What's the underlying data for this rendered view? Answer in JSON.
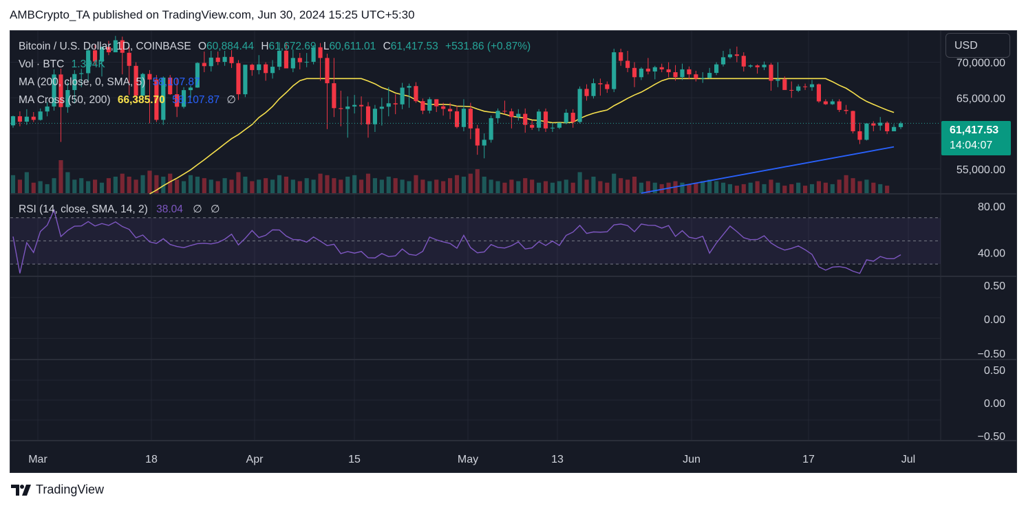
{
  "header": {
    "published_line": "AMBCrypto_TA published on TradingView.com, Jun 30, 2024 15:25 UTC+5:30"
  },
  "legend": {
    "symbol": "Bitcoin / U.S. Dollar, 1D, COINBASE",
    "open_label": "O",
    "open": "60,884.44",
    "high_label": "H",
    "high": "61,672.69",
    "low_label": "L",
    "low": "60,611.01",
    "close_label": "C",
    "close": "61,417.53",
    "change": "+531.86 (+0.87%)",
    "vol_label": "Vol · BTC",
    "vol_value": "1.394K",
    "ma_label": "MA (200, close, 0, SMA, 5)",
    "ma_value": "58,107.87",
    "macross_label": "MA Cross (50, 200)",
    "macross_fast": "66,385.70",
    "macross_slow": "58,107.87",
    "macross_extra": "∅"
  },
  "rsi_legend": {
    "label": "RSI (14, close, SMA, 14, 2)",
    "value": "38.04",
    "extra1": "∅",
    "extra2": "∅"
  },
  "currency_button": "USD",
  "price_badge": {
    "price": "61,417.53",
    "countdown": "14:04:07"
  },
  "footer": {
    "brand": "TradingView"
  },
  "colors": {
    "up": "#26a69a",
    "down": "#f23645",
    "ma200": "#2962ff",
    "ma50": "#f7e14d",
    "rsi": "#7e57c2",
    "bg": "#161a25",
    "grid": "#232733",
    "text": "#d1d4dc"
  },
  "chart_data": {
    "type": "candlestick",
    "x_ticks": [
      "Mar",
      "18",
      "Apr",
      "15",
      "May",
      "13",
      "Jun",
      "17",
      "Jul"
    ],
    "price_axis_ticks": [
      "70,000.00",
      "65,000.00",
      "55,000.00"
    ],
    "rsi_axis_ticks": [
      "80.00",
      "40.00"
    ],
    "empty_pane_1_ticks": [
      "0.50",
      "0.00",
      "−0.50"
    ],
    "empty_pane_2_ticks": [
      "0.50",
      "0.00",
      "−0.50"
    ],
    "ylim_price": [
      51600,
      74400
    ],
    "ylim_rsi": [
      20,
      90
    ],
    "last_price": 61417.53,
    "candles": [
      [
        61132,
        62500,
        60800,
        62410
      ],
      [
        62410,
        63100,
        61000,
        61650
      ],
      [
        61650,
        63400,
        61200,
        62350
      ],
      [
        62350,
        63000,
        61600,
        61900
      ],
      [
        61900,
        63500,
        61800,
        63080
      ],
      [
        63080,
        64400,
        62400,
        63780
      ],
      [
        63780,
        69000,
        63200,
        68280
      ],
      [
        68280,
        69100,
        58800,
        63700
      ],
      [
        63700,
        67200,
        62900,
        66090
      ],
      [
        66090,
        68900,
        64200,
        68340
      ],
      [
        68340,
        69050,
        66500,
        68460
      ],
      [
        68460,
        72000,
        67400,
        71670
      ],
      [
        71670,
        72500,
        69600,
        70100
      ],
      [
        70100,
        72200,
        68000,
        72150
      ],
      [
        72150,
        73000,
        71000,
        71400
      ],
      [
        71400,
        73700,
        72000,
        73090
      ],
      [
        73090,
        73600,
        68300,
        71330
      ],
      [
        71330,
        72400,
        65400,
        69490
      ],
      [
        69490,
        70000,
        64500,
        65320
      ],
      [
        65320,
        68500,
        64800,
        68350
      ],
      [
        68350,
        68900,
        61400,
        67570
      ],
      [
        67570,
        68200,
        61600,
        61900
      ],
      [
        61900,
        68000,
        61200,
        67840
      ],
      [
        67840,
        68200,
        65400,
        65500
      ],
      [
        65500,
        67700,
        62300,
        63740
      ],
      [
        63740,
        66500,
        63500,
        66080
      ],
      [
        66080,
        66700,
        65000,
        66440
      ],
      [
        66440,
        70000,
        66400,
        69900
      ],
      [
        69900,
        71500,
        68600,
        69450
      ],
      [
        69450,
        71600,
        68700,
        70650
      ],
      [
        70650,
        71500,
        69600,
        70050
      ],
      [
        70050,
        71600,
        69500,
        70750
      ],
      [
        70750,
        71700,
        69200,
        69870
      ],
      [
        69870,
        70300,
        64700,
        65500
      ],
      [
        65500,
        69600,
        65100,
        69650
      ],
      [
        69650,
        69800,
        68100,
        68900
      ],
      [
        68900,
        71000,
        68300,
        69700
      ],
      [
        69700,
        70000,
        67400,
        68480
      ],
      [
        68480,
        70300,
        67700,
        69370
      ],
      [
        69370,
        72800,
        68900,
        71620
      ],
      [
        71620,
        72800,
        69600,
        69140
      ],
      [
        69140,
        71800,
        68600,
        70600
      ],
      [
        70600,
        71300,
        69000,
        70000
      ],
      [
        70000,
        71300,
        69300,
        70060
      ],
      [
        70060,
        72400,
        69700,
        72100
      ],
      [
        72100,
        72700,
        67400,
        70600
      ],
      [
        70600,
        71200,
        60600,
        67050
      ],
      [
        67050,
        70600,
        62300,
        63550
      ],
      [
        63550,
        66000,
        61000,
        63430
      ],
      [
        63430,
        65200,
        59400,
        63780
      ],
      [
        63780,
        65400,
        62800,
        64000
      ],
      [
        64000,
        65200,
        61200,
        63800
      ],
      [
        63800,
        64400,
        59400,
        61280
      ],
      [
        61280,
        64000,
        60200,
        63460
      ],
      [
        63460,
        65000,
        61100,
        63750
      ],
      [
        63750,
        66500,
        62400,
        64230
      ],
      [
        64230,
        65500,
        62700,
        64080
      ],
      [
        64080,
        67100,
        63400,
        66430
      ],
      [
        66430,
        67000,
        63600,
        66650
      ],
      [
        66650,
        67200,
        64300,
        64530
      ],
      [
        64530,
        64900,
        62700,
        63200
      ],
      [
        63200,
        65100,
        62800,
        64800
      ],
      [
        64800,
        64800,
        63000,
        63800
      ],
      [
        63800,
        64300,
        62500,
        63440
      ],
      [
        63440,
        64300,
        62000,
        63100
      ],
      [
        63100,
        63900,
        60700,
        60900
      ],
      [
        60900,
        64800,
        60300,
        63470
      ],
      [
        63470,
        64300,
        59200,
        60700
      ],
      [
        60700,
        61200,
        57000,
        58300
      ],
      [
        58300,
        60000,
        56500,
        59100
      ],
      [
        59100,
        62500,
        58700,
        62140
      ],
      [
        62140,
        63500,
        61400,
        63160
      ],
      [
        63160,
        64600,
        62700,
        63100
      ],
      [
        63100,
        63500,
        60700,
        62300
      ],
      [
        62300,
        63400,
        61800,
        62750
      ],
      [
        62750,
        63500,
        60100,
        61200
      ],
      [
        61200,
        61800,
        60500,
        60800
      ],
      [
        60800,
        63400,
        60300,
        63070
      ],
      [
        63070,
        63500,
        60200,
        60700
      ],
      [
        60700,
        61400,
        60200,
        60800
      ],
      [
        60800,
        61500,
        60600,
        61500
      ],
      [
        61500,
        63400,
        61300,
        62900
      ],
      [
        62900,
        63400,
        60800,
        61600
      ],
      [
        61600,
        66600,
        61400,
        66250
      ],
      [
        66250,
        66900,
        64600,
        65250
      ],
      [
        65250,
        67700,
        64900,
        67050
      ],
      [
        67050,
        67700,
        65300,
        66900
      ],
      [
        66900,
        67300,
        65700,
        66230
      ],
      [
        66230,
        71900,
        65800,
        71400
      ],
      [
        71400,
        71900,
        69500,
        70200
      ],
      [
        70200,
        71600,
        68600,
        69200
      ],
      [
        69200,
        70000,
        66500,
        67900
      ],
      [
        67900,
        69300,
        67500,
        69100
      ],
      [
        69100,
        70600,
        68300,
        68700
      ],
      [
        68700,
        69500,
        67600,
        69300
      ],
      [
        69300,
        69800,
        68600,
        69000
      ],
      [
        69000,
        70000,
        67900,
        68600
      ],
      [
        68600,
        69600,
        67400,
        67900
      ],
      [
        67900,
        69800,
        67500,
        69000
      ],
      [
        69000,
        69400,
        67600,
        68300
      ],
      [
        68300,
        68800,
        67300,
        67700
      ],
      [
        67700,
        68600,
        67100,
        67800
      ],
      [
        67800,
        69200,
        67700,
        68500
      ],
      [
        68500,
        70000,
        68200,
        69700
      ],
      [
        69700,
        71600,
        69400,
        70700
      ],
      [
        70700,
        71900,
        70500,
        71100
      ],
      [
        71100,
        72200,
        70000,
        70900
      ],
      [
        70900,
        71400,
        68700,
        69400
      ],
      [
        69400,
        69700,
        69200,
        69550
      ],
      [
        69550,
        69700,
        68400,
        69300
      ],
      [
        69300,
        70100,
        68900,
        69650
      ],
      [
        69650,
        69900,
        66000,
        67400
      ],
      [
        67400,
        70000,
        66500,
        67600
      ],
      [
        67600,
        68000,
        66300,
        66100
      ],
      [
        66100,
        67300,
        65000,
        66000
      ],
      [
        66000,
        66900,
        65800,
        66600
      ],
      [
        66600,
        67000,
        66100,
        66500
      ],
      [
        66500,
        67500,
        66000,
        66900
      ],
      [
        66900,
        67000,
        64300,
        64500
      ],
      [
        64500,
        64800,
        64000,
        64100
      ],
      [
        64100,
        64800,
        64000,
        64500
      ],
      [
        64500,
        64800,
        63000,
        63300
      ],
      [
        63300,
        64000,
        62700,
        63150
      ],
      [
        63150,
        63200,
        60000,
        60300
      ],
      [
        60300,
        61500,
        58500,
        59100
      ],
      [
        59100,
        61200,
        59000,
        61400
      ],
      [
        61400,
        61700,
        60300,
        61100
      ],
      [
        61100,
        62300,
        60400,
        61500
      ],
      [
        61500,
        61700,
        59900,
        60300
      ],
      [
        60300,
        61300,
        60300,
        60900
      ],
      [
        60884,
        61673,
        60611,
        61418
      ]
    ],
    "volume_approx_btc": [
      12,
      9,
      14,
      7,
      8,
      6,
      10,
      22,
      14,
      9,
      10,
      8,
      9,
      7,
      10,
      11,
      13,
      11,
      9,
      12,
      15,
      12,
      11,
      13,
      9,
      8,
      12,
      11,
      10,
      9,
      8,
      10,
      9,
      14,
      11,
      8,
      9,
      10,
      9,
      12,
      11,
      9,
      8,
      10,
      9,
      13,
      12,
      10,
      9,
      11,
      12,
      9,
      13,
      10,
      9,
      11,
      10,
      9,
      8,
      12,
      9,
      8,
      9,
      8,
      10,
      12,
      11,
      13,
      16,
      11,
      9,
      8,
      7,
      9,
      8,
      10,
      9,
      7,
      8,
      7,
      8,
      9,
      7,
      14,
      9,
      11,
      8,
      7,
      13,
      10,
      9,
      11,
      7,
      8,
      7,
      6,
      7,
      8,
      7,
      6,
      7,
      8,
      9,
      8,
      7,
      6,
      5,
      6,
      7,
      8,
      6,
      9,
      7,
      5,
      6,
      7,
      5,
      6,
      8,
      7,
      6,
      9,
      12,
      10,
      8,
      9,
      7,
      6,
      5
    ],
    "ma200_approx": {
      "x_index_range": [
        92,
        129
      ],
      "y_range": [
        51600,
        58108
      ]
    },
    "ma50_approx": {
      "x_index_range": [
        20,
        129
      ],
      "y_range": [
        51500,
        67700
      ],
      "last": 66385.7
    },
    "rsi_last": 38.04,
    "rsi_bands": [
      70,
      50,
      30
    ]
  }
}
